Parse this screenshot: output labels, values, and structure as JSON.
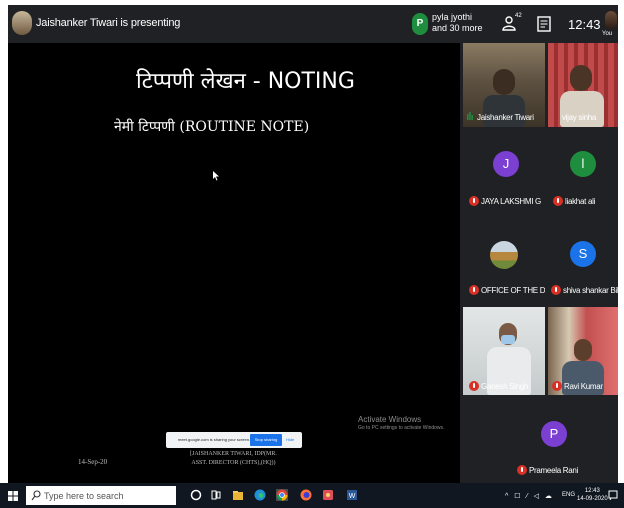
{
  "meet": {
    "presenter_label": "Jaishanker Tiwari is presenting",
    "pinned_initial": "P",
    "pinned_user_line1": "pyla jyothi",
    "pinned_user_line2": "and 30 more",
    "people_icon": "people-icon",
    "people_count": "42",
    "chat_icon": "chat-icon",
    "clock": "12:43",
    "self_label": "You"
  },
  "slide": {
    "title": "टिप्पणी लेखन - NOTING",
    "subtitle": "नेमी टिप्पणी (ROUTINE NOTE)",
    "date": "14-Sep-20",
    "footer_line1": "[JAISHANKER TIWARI, IDP(MR.",
    "footer_line2": "ASST. DIRECTOR (CHTS),(HQ))"
  },
  "watermark": {
    "title": "Activate Windows",
    "subtitle": "Go to PC settings to activate Windows."
  },
  "share_notice": {
    "text": "meet.google.com is sharing your screen.",
    "stop_label": "Stop sharing",
    "hide_label": "Hide"
  },
  "participants": [
    {
      "name": "Jaishanker Tiwari",
      "kind": "video",
      "mic": "speaking"
    },
    {
      "name": "vijay sinha",
      "kind": "video",
      "mic": "on"
    },
    {
      "name": "JAYA LAKSHMI G",
      "kind": "initial",
      "initial": "J",
      "color": "#7b3fd1",
      "mic": "off"
    },
    {
      "name": "liakhat ali",
      "kind": "initial",
      "initial": "l",
      "color": "#1e8e3e",
      "mic": "off"
    },
    {
      "name": "OFFICE OF THE DIRE...",
      "kind": "photo",
      "mic": "off"
    },
    {
      "name": "shiva shankar Billa",
      "kind": "initial",
      "initial": "S",
      "color": "#1a73e8",
      "mic": "off"
    },
    {
      "name": "Ganesh Singh",
      "kind": "video",
      "mic": "off"
    },
    {
      "name": "Ravi Kumar",
      "kind": "video",
      "mic": "off"
    },
    {
      "name": "Prameela Rani",
      "kind": "initial",
      "initial": "P",
      "color": "#7b3fd1",
      "mic": "off"
    }
  ],
  "taskbar": {
    "search_placeholder": "Type here to search",
    "apps": [
      "cortana-icon",
      "task-view-icon",
      "file-explorer-icon",
      "edge-icon",
      "chrome-icon",
      "firefox-icon",
      "paint-icon",
      "word-icon"
    ],
    "tray_icons": "^ ☐ ⁄ ◁ ☁",
    "lang": "ENG",
    "time": "12:43",
    "date": "14-09-2020"
  },
  "colors": {
    "meet_bar": "#202124",
    "mic_off": "#d93025",
    "accent_blue": "#1a73e8",
    "taskbar": "#101720"
  }
}
